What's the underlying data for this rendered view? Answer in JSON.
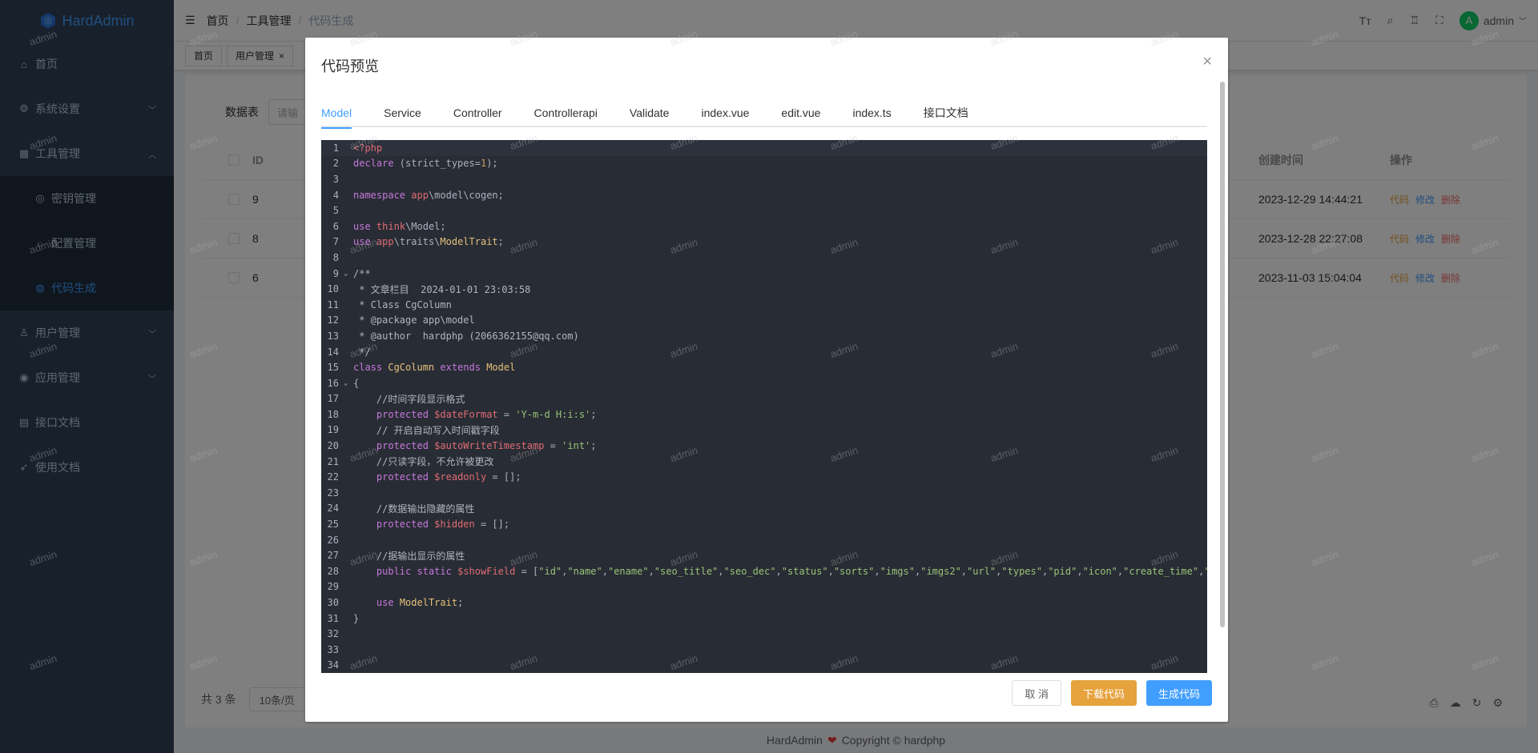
{
  "app": {
    "title": "HardAdmin"
  },
  "sidebar": {
    "items": [
      {
        "label": "首页",
        "icon": "home-icon"
      },
      {
        "label": "系统设置",
        "icon": "gear-icon"
      },
      {
        "label": "工具管理",
        "icon": "grid-icon"
      },
      {
        "label": "密钥管理",
        "icon": "key-icon"
      },
      {
        "label": "配置管理",
        "icon": "config-icon"
      },
      {
        "label": "代码生成",
        "icon": "code-icon"
      },
      {
        "label": "用户管理",
        "icon": "user-icon"
      },
      {
        "label": "应用管理",
        "icon": "broadcast-icon"
      },
      {
        "label": "接口文档",
        "icon": "doc-icon"
      },
      {
        "label": "使用文档",
        "icon": "rocket-icon"
      }
    ]
  },
  "breadcrumb": [
    "首页",
    "工具管理",
    "代码生成"
  ],
  "header": {
    "user": "admin",
    "avatar_letter": "A"
  },
  "tags": [
    "首页",
    "用户管理"
  ],
  "page": {
    "search_label": "数据表",
    "search_placeholder": "请输",
    "table_headers": {
      "id": "ID",
      "create_time": "创建时间",
      "ops": "操作"
    },
    "rows": [
      {
        "id": "9",
        "create_time": "2023-12-29 14:44:21"
      },
      {
        "id": "8",
        "create_time": "2023-12-28 22:27:08"
      },
      {
        "id": "6",
        "create_time": "2023-11-03 15:04:04"
      }
    ],
    "ops": {
      "code": "代码",
      "edit": "修改",
      "delete": "删除"
    },
    "total": "共 3 条",
    "page_size": "10条/页"
  },
  "footer": {
    "brand": "HardAdmin",
    "copyright": "Copyright © hardphp"
  },
  "watermark": "admin",
  "dialog": {
    "title": "代码预览",
    "tabs": [
      "Model",
      "Service",
      "Controller",
      "Controllerapi",
      "Validate",
      "index.vue",
      "edit.vue",
      "index.ts",
      "接口文档"
    ],
    "active_tab": "Model",
    "buttons": {
      "cancel": "取 消",
      "download": "下载代码",
      "generate": "生成代码"
    },
    "code_lines": [
      "<?php",
      "declare (strict_types=1);",
      "",
      "namespace app\\model\\cogen;",
      "",
      "use think\\Model;",
      "use app\\traits\\ModelTrait;",
      "",
      "/**",
      " * 文章栏目  2024-01-01 23:03:58",
      " * Class CgColumn",
      " * @package app\\model",
      " * @author  hardphp (2066362155@qq.com)",
      " */",
      "class CgColumn extends Model",
      "{",
      "    //时间字段显示格式",
      "    protected $dateFormat = 'Y-m-d H:i:s';",
      "    // 开启自动写入时间戳字段",
      "    protected $autoWriteTimestamp = 'int';",
      "    //只读字段，不允许被更改",
      "    protected $readonly = [];",
      "",
      "    //数据输出隐藏的属性",
      "    protected $hidden = [];",
      "",
      "    //据输出显示的属性",
      "    public static $showField = [\"id\",\"name\",\"ename\",\"seo_title\",\"seo_dec\",\"status\",\"sorts\",\"imgs\",\"imgs2\",\"url\",\"types\",\"pid\",\"icon\",\"create_time\",\"update_time\"];",
      "",
      "    use ModelTrait;",
      "}",
      "",
      "",
      ""
    ]
  },
  "colors": {
    "primary": "#409eff",
    "warning": "#e6a23c",
    "danger": "#f56c6c",
    "sidebar": "#304156",
    "editor_bg": "#282c34"
  }
}
